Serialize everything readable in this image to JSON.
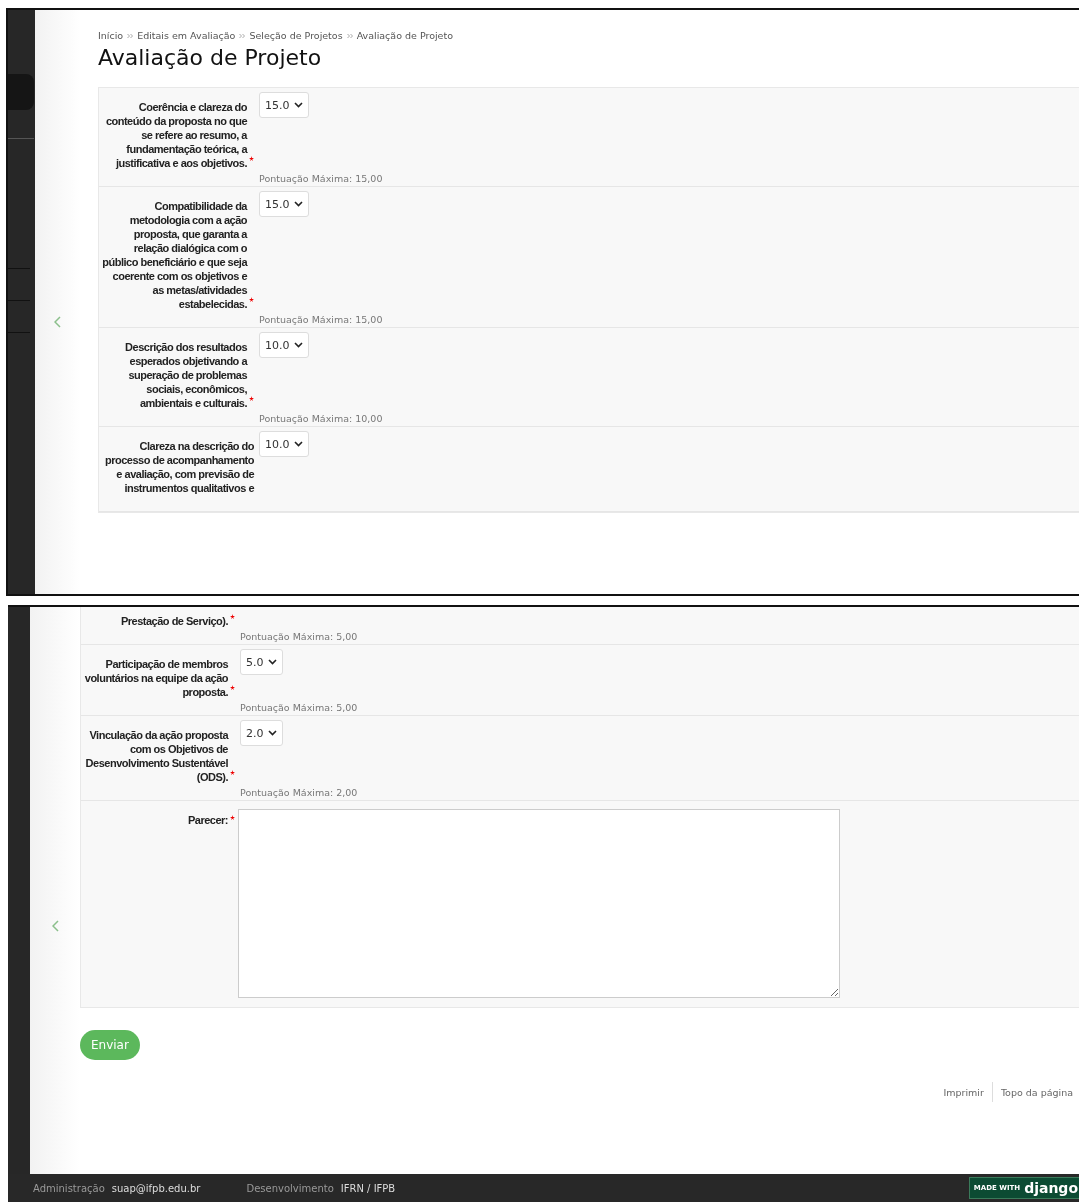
{
  "panels": [
    {
      "kind": "top",
      "breadcrumb": [
        "Início",
        "Editais em Avaliação",
        "Seleção de Projetos",
        "Avaliação de Projeto"
      ],
      "title": "Avaliação de Projeto",
      "fields": [
        {
          "label": "Coerência e clareza do conteúdo da proposta no que se refere ao resumo, a fundamentação teórica, a justificativa e aos objetivos.",
          "required": true,
          "value": "15.0",
          "max_score": "Pontuação Máxima: 15,00"
        },
        {
          "label": "Compatibilidade da metodologia com a ação proposta, que garanta a relação dialógica com o público beneficiário e que seja coerente com os objetivos e as metas/atividades estabelecidas.",
          "required": true,
          "value": "15.0",
          "max_score": "Pontuação Máxima: 15,00"
        },
        {
          "label": "Descrição dos resultados esperados objetivando a superação de problemas sociais, econômicos, ambientais e culturais.",
          "required": true,
          "value": "10.0",
          "max_score": "Pontuação Máxima: 10,00"
        },
        {
          "label": "Clareza na descrição do processo de acompanhamento e avaliação, com previsão de instrumentos qualitativos e",
          "value": "10.0"
        }
      ]
    },
    {
      "kind": "bottom",
      "fields": [
        {
          "label": "Prestação de Serviço).",
          "required": true,
          "max_score": "Pontuação Máxima: 5,00"
        },
        {
          "label": "Participação de membros voluntários na equipe da ação proposta.",
          "required": true,
          "value": "5.0",
          "max_score": "Pontuação Máxima: 5,00"
        },
        {
          "label": "Vinculação da ação proposta com os Objetivos de Desenvolvimento Sustentável (ODS).",
          "required": true,
          "value": "2.0",
          "max_score": "Pontuação Máxima: 2,00"
        }
      ],
      "parecer": {
        "label": "Parecer:",
        "required": true
      },
      "submit": "Enviar",
      "page_links": [
        "Imprimir",
        "Topo da página"
      ],
      "footer": [
        {
          "label": "Administração",
          "value": "suap@ifpb.edu.br"
        },
        {
          "label": "Desenvolvimento",
          "value": "IFRN / IFPB"
        }
      ],
      "badge": {
        "prefix": "MADE WITH",
        "brand": "django"
      }
    }
  ]
}
